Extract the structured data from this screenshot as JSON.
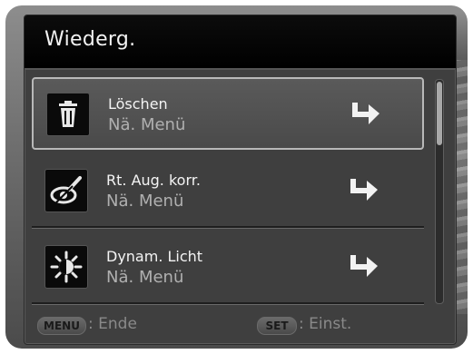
{
  "menu": {
    "title": "Wiederg.",
    "items": [
      {
        "icon": "trash-icon",
        "label": "Löschen",
        "sub": "Nä. Menü",
        "selected": true
      },
      {
        "icon": "red-eye-correction-icon",
        "label": "Rt. Aug. korr.",
        "sub": "Nä. Menü",
        "selected": false
      },
      {
        "icon": "dynamic-light-icon",
        "label": "Dynam. Licht",
        "sub": "Nä. Menü",
        "selected": false
      }
    ]
  },
  "footer": {
    "menu_key": "MENU",
    "menu_action": ": Ende",
    "set_key": "SET",
    "set_action": ": Einst."
  },
  "colors": {
    "panel": "#3f3f3f",
    "title_bar": "#000000",
    "selection_border": "#b8b8b8"
  }
}
